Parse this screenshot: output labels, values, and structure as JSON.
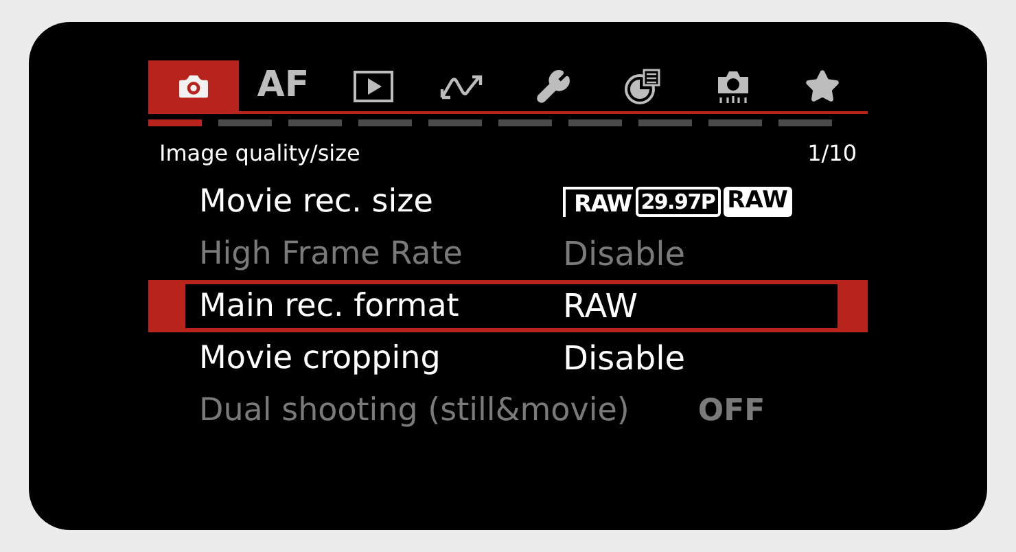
{
  "tabs": [
    {
      "kind": "camera",
      "selected": true
    },
    {
      "kind": "text",
      "label": "AF",
      "selected": false
    },
    {
      "kind": "play",
      "selected": false
    },
    {
      "kind": "wave",
      "selected": false
    },
    {
      "kind": "wrench",
      "selected": false
    },
    {
      "kind": "chart",
      "selected": false
    },
    {
      "kind": "camera-dots",
      "selected": false
    },
    {
      "kind": "star",
      "selected": false
    }
  ],
  "pages": [
    {
      "selected": true
    },
    {
      "selected": false
    },
    {
      "selected": false
    },
    {
      "selected": false
    },
    {
      "selected": false
    },
    {
      "selected": false
    },
    {
      "selected": false
    },
    {
      "selected": false
    },
    {
      "selected": false
    },
    {
      "selected": false
    }
  ],
  "header": {
    "title": "Image quality/size",
    "page": "1/10"
  },
  "rows": [
    {
      "label": "Movie rec. size",
      "kind": "badges",
      "disabled": false,
      "selected": false,
      "value": [
        {
          "kind": "film",
          "text": "RAW"
        },
        {
          "kind": "outline",
          "text": "29.97P"
        },
        {
          "kind": "filled",
          "text": "RAW"
        }
      ]
    },
    {
      "label": "High Frame Rate",
      "kind": "text",
      "disabled": true,
      "selected": false,
      "value": "Disable"
    },
    {
      "label": "Main rec. format",
      "kind": "text",
      "disabled": false,
      "selected": true,
      "value": "RAW"
    },
    {
      "label": "Movie cropping",
      "kind": "text",
      "disabled": false,
      "selected": false,
      "value": "Disable"
    },
    {
      "label": "Dual shooting (still&movie)",
      "kind": "switch",
      "disabled": true,
      "selected": false,
      "value": "OFF"
    }
  ]
}
